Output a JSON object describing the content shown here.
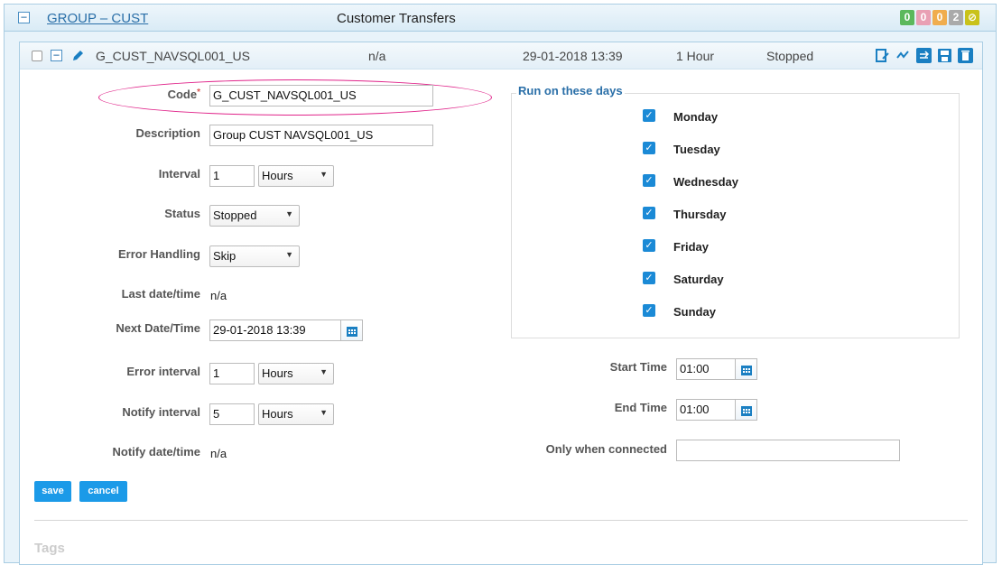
{
  "group": {
    "title": "GROUP – CUST",
    "description": "Customer Transfers",
    "badges": [
      {
        "value": "0",
        "color": "#5cb85c"
      },
      {
        "value": "0",
        "color": "#e9a0b4"
      },
      {
        "value": "0",
        "color": "#f0ad4e"
      },
      {
        "value": "2",
        "color": "#aaaaaa"
      },
      {
        "value": "⊘",
        "color": "#c9c21a"
      }
    ]
  },
  "job": {
    "name": "G_CUST_NAVSQL001_US",
    "last_run": "n/a",
    "next_run": "29-01-2018 13:39",
    "interval": "1 Hour",
    "status": "Stopped",
    "icons": [
      "edit-icon",
      "activity-icon",
      "refresh-icon",
      "save-icon",
      "trash-icon"
    ]
  },
  "form": {
    "code_label": "Code",
    "code_value": "G_CUST_NAVSQL001_US",
    "description_label": "Description",
    "description_value": "Group CUST NAVSQL001_US",
    "interval_label": "Interval",
    "interval_value": "1",
    "interval_unit": "Hours",
    "status_label": "Status",
    "status_value": "Stopped",
    "error_handling_label": "Error Handling",
    "error_handling_value": "Skip",
    "last_datetime_label": "Last date/time",
    "last_datetime_value": "n/a",
    "next_datetime_label": "Next Date/Time",
    "next_datetime_value": "29-01-2018 13:39",
    "error_interval_label": "Error interval",
    "error_interval_value": "1",
    "error_interval_unit": "Hours",
    "notify_interval_label": "Notify interval",
    "notify_interval_value": "5",
    "notify_interval_unit": "Hours",
    "notify_datetime_label": "Notify date/time",
    "notify_datetime_value": "n/a",
    "run_days_legend": "Run on these days",
    "days": [
      {
        "label": "Monday",
        "checked": true
      },
      {
        "label": "Tuesday",
        "checked": true
      },
      {
        "label": "Wednesday",
        "checked": true
      },
      {
        "label": "Thursday",
        "checked": true
      },
      {
        "label": "Friday",
        "checked": true
      },
      {
        "label": "Saturday",
        "checked": true
      },
      {
        "label": "Sunday",
        "checked": true
      }
    ],
    "start_time_label": "Start Time",
    "start_time_value": "01:00",
    "end_time_label": "End Time",
    "end_time_value": "01:00",
    "only_connected_label": "Only when connected",
    "only_connected_value": "",
    "save_label": "save",
    "cancel_label": "cancel",
    "tags_label": "Tags"
  }
}
